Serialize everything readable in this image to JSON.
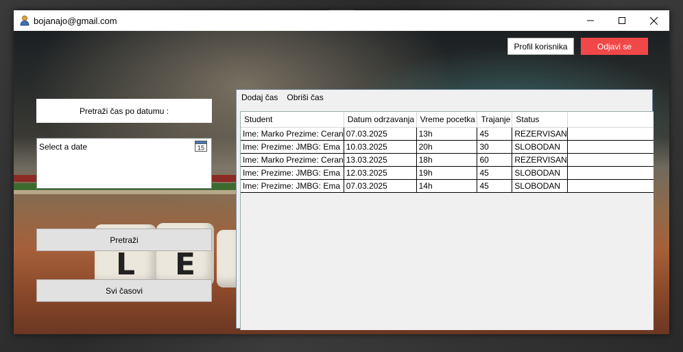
{
  "window": {
    "title": "bojanajo@gmail.com"
  },
  "header": {
    "profile_label": "Profil korisnika",
    "logout_label": "Odjavi se",
    "logout_color": "#f04848"
  },
  "left": {
    "search_label": "Pretraži čas po datumu :",
    "date_placeholder": "Select a date",
    "calendar_day": "15",
    "search_button": "Pretraži",
    "all_button": "Svi časovi"
  },
  "menu": {
    "add": "Dodaj čas",
    "remove": "Obriši čas"
  },
  "table": {
    "columns": [
      "Student",
      "Datum odrzavanja",
      "Vreme pocetka",
      "Trajanje",
      "Status"
    ],
    "rows": [
      [
        "Ime: Marko Prezime: Ceran",
        "07.03.2025",
        "13h",
        "45",
        "REZERVISAN"
      ],
      [
        "Ime:  Prezime:  JMBG:  Ema",
        "10.03.2025",
        "20h",
        "30",
        "SLOBODAN"
      ],
      [
        "Ime: Marko Prezime: Ceran",
        "13.03.2025",
        "18h",
        "60",
        "REZERVISAN"
      ],
      [
        "Ime:  Prezime:  JMBG:  Ema",
        "12.03.2025",
        "19h",
        "45",
        "SLOBODAN"
      ],
      [
        "Ime:  Prezime:  JMBG:  Ema",
        "07.03.2025",
        "14h",
        "45",
        "SLOBODAN"
      ]
    ]
  }
}
